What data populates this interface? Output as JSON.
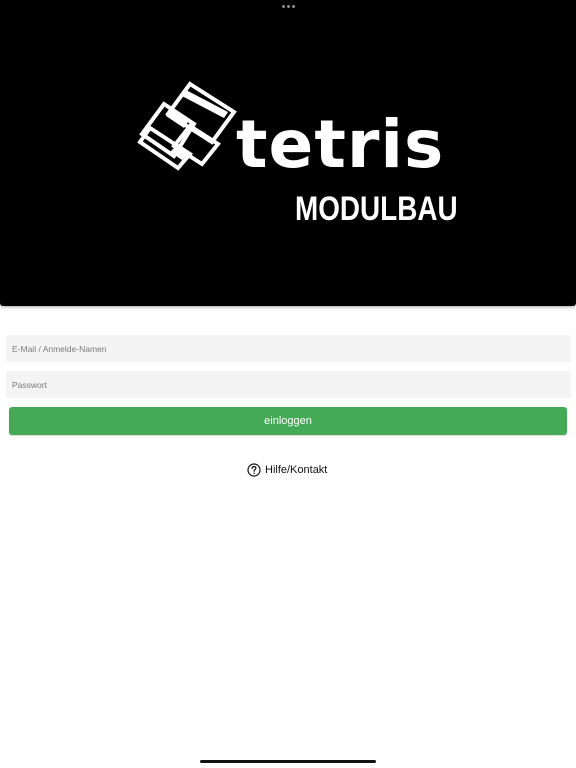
{
  "header": {
    "logo_word": "tetris",
    "logo_subtitle": "MODULBAU",
    "background": "#000000"
  },
  "form": {
    "email_placeholder": "E-Mail / Anmelde-Namen",
    "email_value": "",
    "password_placeholder": "Passwort",
    "password_value": "",
    "login_label": "einloggen",
    "login_color": "#45aa55"
  },
  "help": {
    "icon": "question-circle-icon",
    "label": "Hilfe/Kontakt"
  }
}
